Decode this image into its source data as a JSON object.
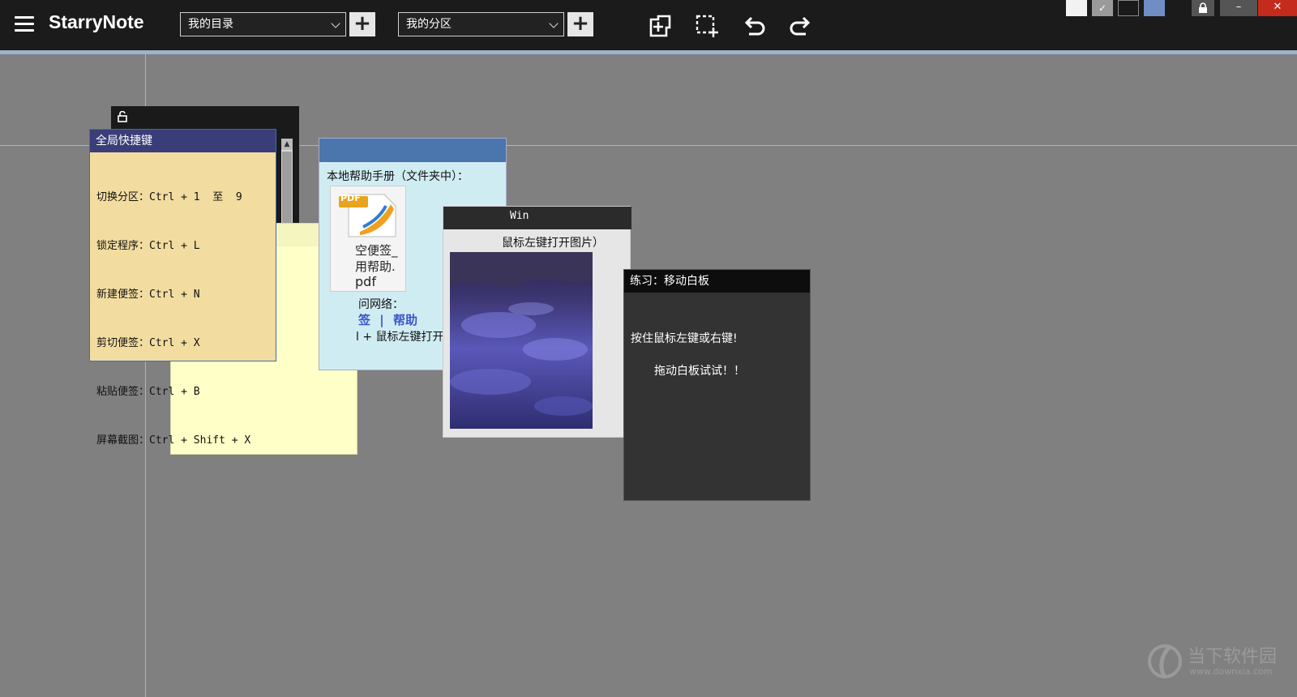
{
  "app": {
    "title": "StarryNote"
  },
  "toolbar": {
    "catalog_select": {
      "value": "我的目录"
    },
    "partition_select": {
      "value": "我的分区"
    },
    "add_catalog_label": "+",
    "add_partition_label": "+",
    "theme_swatches": [
      "#f2f2f2",
      "#9a9a9a",
      "#1a1a1a",
      "#6f8fc4"
    ]
  },
  "notes": {
    "shortcuts": {
      "title": "全局快捷键",
      "lines": [
        "切换分区：Ctrl + 1  至  9",
        "锁定程序：Ctrl + L",
        "新建便签：Ctrl + N",
        "剪切便签：Ctrl + X",
        "粘贴便签：Ctrl + B",
        "屏幕截图：Ctrl + Shift + X"
      ]
    },
    "help": {
      "line1": "本地帮助手册（文件夹中）：",
      "file_lines": [
        "空便签_",
        "用帮助.",
        "pdf"
      ],
      "pdf_badge": "PDF",
      "line2": "问网络：",
      "link1": "签",
      "separator": "|",
      "link2": "帮助",
      "line3": "l + 鼠标左键打开）"
    },
    "image": {
      "title": "Win",
      "caption": "鼠标左键打开图片）"
    },
    "whiteboard": {
      "title": "练习：移动白板",
      "line1": "按住鼠标左键或右键!",
      "line2": "拖动白板试试！！"
    }
  },
  "watermark": {
    "cn": "当下软件园",
    "url": "www.downxia.com"
  },
  "colors": {
    "toolbar_bg": "#1b1b1b",
    "canvas_bg": "#808080",
    "accent": "#4a6fa5"
  }
}
